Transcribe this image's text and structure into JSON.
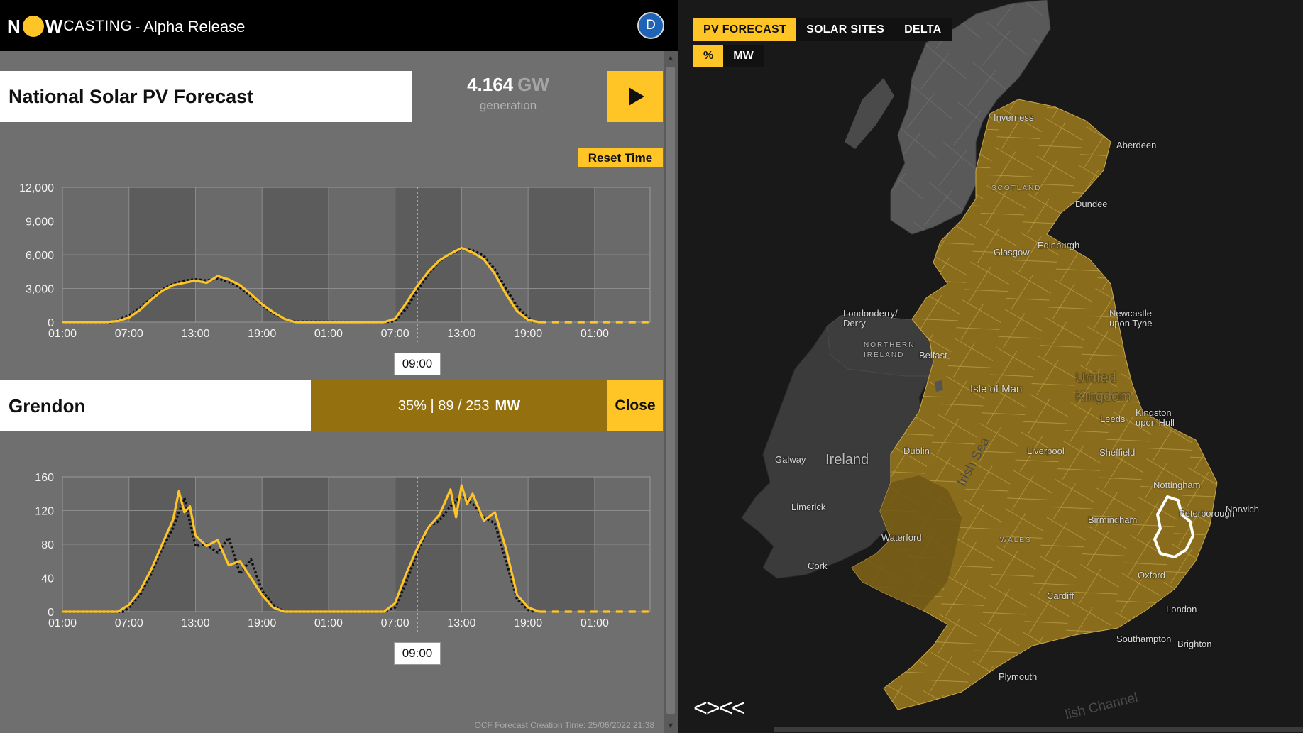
{
  "header": {
    "logo_n": "N",
    "logo_w": "W",
    "logo_rest": "CASTING",
    "release": "- Alpha Release",
    "avatar_letter": "D"
  },
  "national": {
    "title": "National Solar PV Forecast",
    "generation_value": "4.164",
    "generation_unit": "GW",
    "generation_label": "generation",
    "reset_label": "Reset Time",
    "time_label": "09:00"
  },
  "region": {
    "name": "Grendon",
    "stats": "35% | 89 / 253",
    "unit": "MW",
    "close_label": "Close",
    "time_label": "09:00"
  },
  "footer": {
    "creation_time": "OCF Forecast Creation Time: 25/06/2022 21:38"
  },
  "map": {
    "tabs": [
      {
        "label": "PV FORECAST",
        "active": true
      },
      {
        "label": "SOLAR SITES",
        "active": false
      },
      {
        "label": "DELTA",
        "active": false
      }
    ],
    "units": [
      {
        "label": "%",
        "active": true
      },
      {
        "label": "MW",
        "active": false
      }
    ],
    "nav_arrows": "<><<",
    "labels": {
      "inverness": "Inverness",
      "aberdeen": "Aberdeen",
      "scotland": "SCOTLAND",
      "dundee": "Dundee",
      "glasgow": "Glasgow",
      "edinburgh": "Edinburgh",
      "newcastle": "Newcastle\nupon Tyne",
      "londonderry": "Londonderry/\nDerry",
      "northern_ireland": "NORTHERN\nIRELAND",
      "belfast": "Belfast",
      "isle_of_man": "Isle of Man",
      "united_kingdom": "United\nKingdom",
      "ireland": "Ireland",
      "dublin": "Dublin",
      "galway": "Galway",
      "irish_sea": "Irish Sea",
      "leeds": "Leeds",
      "kingston": "Kingston\nupon Hull",
      "liverpool": "Liverpool",
      "sheffield": "Sheffield",
      "nottingham": "Nottingham",
      "limerick": "Limerick",
      "birmingham": "Birmingham",
      "peterborough": "Peterborough",
      "norwich": "Norwich",
      "wales": "WALES",
      "waterford": "Waterford",
      "cork": "Cork",
      "oxford": "Oxford",
      "cardiff": "Cardiff",
      "london": "London",
      "southampton": "Southampton",
      "brighton": "Brighton",
      "plymouth": "Plymouth",
      "english_channel": "lish Channel"
    }
  },
  "chart_data": [
    {
      "type": "line",
      "name": "national",
      "x_ticks": [
        "01:00",
        "07:00",
        "13:00",
        "19:00",
        "01:00",
        "07:00",
        "13:00",
        "19:00",
        "01:00"
      ],
      "ylim": [
        0,
        12000
      ],
      "y_ticks": [
        "0",
        "3,000",
        "6,000",
        "9,000",
        "12,000"
      ],
      "x_range_hours": [
        0,
        53
      ],
      "now_hour": 32,
      "forecast": [
        [
          0,
          0
        ],
        [
          4,
          0
        ],
        [
          5,
          100
        ],
        [
          6,
          400
        ],
        [
          7,
          1100
        ],
        [
          8,
          2000
        ],
        [
          9,
          2800
        ],
        [
          10,
          3300
        ],
        [
          11,
          3500
        ],
        [
          12,
          3700
        ],
        [
          13,
          3500
        ],
        [
          14,
          4100
        ],
        [
          15,
          3800
        ],
        [
          16,
          3300
        ],
        [
          17,
          2500
        ],
        [
          18,
          1600
        ],
        [
          19,
          900
        ],
        [
          20,
          300
        ],
        [
          21,
          0
        ],
        [
          29,
          0
        ],
        [
          30,
          300
        ],
        [
          31,
          1700
        ],
        [
          32,
          3200
        ],
        [
          33,
          4500
        ],
        [
          34,
          5500
        ],
        [
          35,
          6100
        ],
        [
          36,
          6600
        ],
        [
          37,
          6200
        ],
        [
          38,
          5600
        ],
        [
          39,
          4300
        ],
        [
          40,
          2500
        ],
        [
          41,
          1000
        ],
        [
          42,
          200
        ],
        [
          43,
          0
        ]
      ],
      "forecast_future": [
        [
          43,
          0
        ],
        [
          53,
          0
        ]
      ],
      "actual": [
        [
          0,
          0
        ],
        [
          4.5,
          0
        ],
        [
          5,
          200
        ],
        [
          6,
          600
        ],
        [
          7,
          1300
        ],
        [
          8,
          2100
        ],
        [
          9,
          2900
        ],
        [
          10,
          3400
        ],
        [
          11,
          3700
        ],
        [
          12,
          3800
        ],
        [
          13,
          3700
        ],
        [
          14,
          3900
        ],
        [
          15,
          3600
        ],
        [
          16,
          3100
        ],
        [
          17,
          2300
        ],
        [
          18,
          1500
        ],
        [
          19,
          800
        ],
        [
          20,
          300
        ],
        [
          21,
          50
        ],
        [
          29,
          0
        ],
        [
          30,
          100
        ],
        [
          31,
          1200
        ],
        [
          32,
          2800
        ],
        [
          33,
          4300
        ],
        [
          34,
          5400
        ],
        [
          35,
          6100
        ],
        [
          36,
          6500
        ],
        [
          37,
          6400
        ],
        [
          38,
          5900
        ],
        [
          39,
          4700
        ],
        [
          40,
          3000
        ],
        [
          41,
          1400
        ],
        [
          42,
          400
        ],
        [
          42.5,
          0
        ]
      ]
    },
    {
      "type": "line",
      "name": "grendon",
      "x_ticks": [
        "01:00",
        "07:00",
        "13:00",
        "19:00",
        "01:00",
        "07:00",
        "13:00",
        "19:00",
        "01:00"
      ],
      "ylim": [
        0,
        160
      ],
      "y_ticks": [
        "0",
        "40",
        "80",
        "120",
        "160"
      ],
      "x_range_hours": [
        0,
        53
      ],
      "now_hour": 32,
      "forecast": [
        [
          0,
          0
        ],
        [
          5,
          0
        ],
        [
          6,
          8
        ],
        [
          7,
          25
        ],
        [
          8,
          50
        ],
        [
          9,
          80
        ],
        [
          10,
          110
        ],
        [
          10.5,
          143
        ],
        [
          11,
          118
        ],
        [
          11.5,
          125
        ],
        [
          12,
          90
        ],
        [
          13,
          78
        ],
        [
          14,
          85
        ],
        [
          15,
          55
        ],
        [
          16,
          60
        ],
        [
          17,
          40
        ],
        [
          18,
          20
        ],
        [
          19,
          5
        ],
        [
          20,
          0
        ],
        [
          29,
          0
        ],
        [
          30,
          10
        ],
        [
          31,
          45
        ],
        [
          32,
          75
        ],
        [
          33,
          100
        ],
        [
          34,
          115
        ],
        [
          35,
          145
        ],
        [
          35.5,
          112
        ],
        [
          36,
          150
        ],
        [
          36.5,
          128
        ],
        [
          37,
          140
        ],
        [
          38,
          108
        ],
        [
          39,
          118
        ],
        [
          40,
          75
        ],
        [
          41,
          20
        ],
        [
          42,
          5
        ],
        [
          43,
          0
        ]
      ],
      "forecast_future": [
        [
          43,
          0
        ],
        [
          53,
          0
        ]
      ],
      "actual": [
        [
          0,
          0
        ],
        [
          5.5,
          0
        ],
        [
          6,
          5
        ],
        [
          7,
          20
        ],
        [
          8,
          45
        ],
        [
          9,
          75
        ],
        [
          10,
          100
        ],
        [
          11,
          135
        ],
        [
          12,
          78
        ],
        [
          13,
          80
        ],
        [
          14,
          70
        ],
        [
          15,
          88
        ],
        [
          16,
          45
        ],
        [
          17,
          62
        ],
        [
          18,
          25
        ],
        [
          19,
          8
        ],
        [
          20,
          0
        ],
        [
          29,
          0
        ],
        [
          30,
          5
        ],
        [
          31,
          35
        ],
        [
          32,
          70
        ],
        [
          33,
          100
        ],
        [
          34,
          108
        ],
        [
          35,
          125
        ],
        [
          36,
          138
        ],
        [
          37,
          128
        ],
        [
          38,
          112
        ],
        [
          39,
          105
        ],
        [
          40,
          60
        ],
        [
          41,
          15
        ],
        [
          42,
          2
        ],
        [
          42.5,
          0
        ]
      ]
    }
  ]
}
